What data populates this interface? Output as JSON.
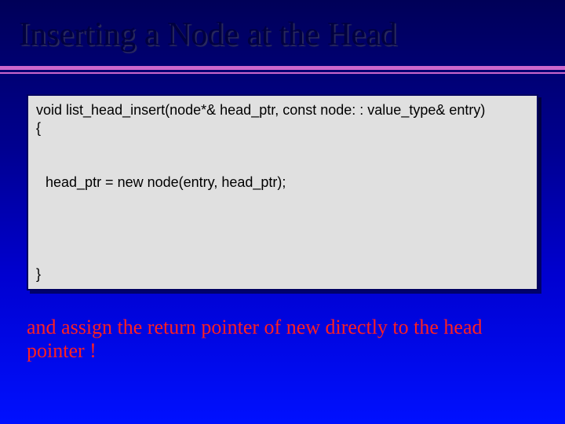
{
  "title": "Inserting a Node at the Head",
  "code": {
    "signature": "void list_head_insert(node*& head_ptr, const node: : value_type& entry)",
    "brace_open": "{",
    "body": "head_ptr = new node(entry, head_ptr);",
    "brace_close": "}"
  },
  "caption_line1": "and assign the return pointer of new directly to the head",
  "caption_line2": "pointer !"
}
